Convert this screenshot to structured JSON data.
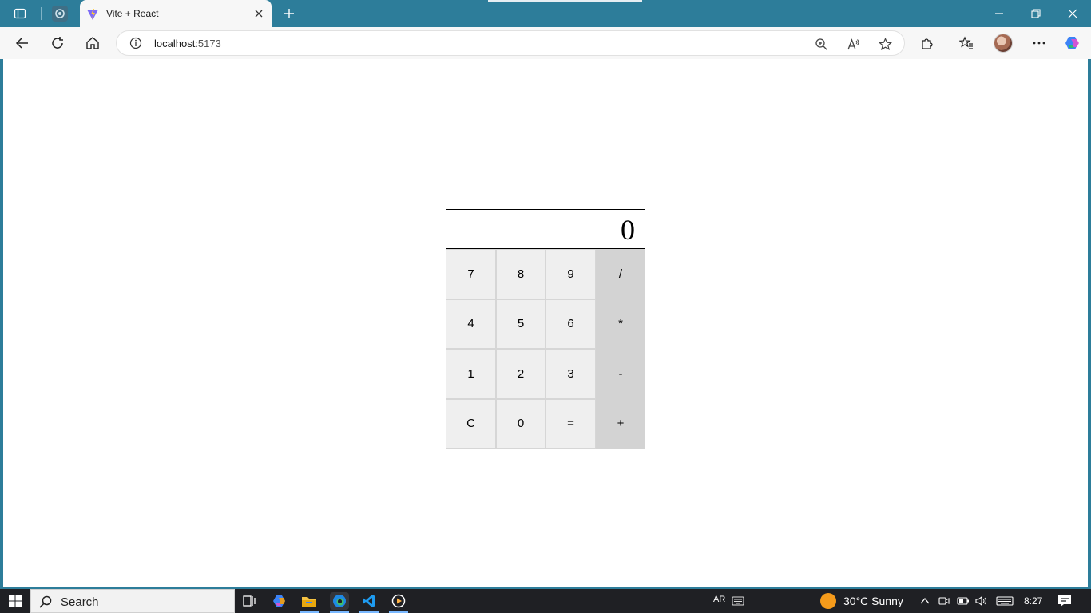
{
  "browser": {
    "tab_active_title": "Vite + React",
    "url_host": "localhost",
    "url_port": ":5173"
  },
  "calculator": {
    "display": "0",
    "keys": [
      {
        "label": "7",
        "kind": "digit"
      },
      {
        "label": "8",
        "kind": "digit"
      },
      {
        "label": "9",
        "kind": "digit"
      },
      {
        "label": "/",
        "kind": "op"
      },
      {
        "label": "4",
        "kind": "digit"
      },
      {
        "label": "5",
        "kind": "digit"
      },
      {
        "label": "6",
        "kind": "digit"
      },
      {
        "label": "*",
        "kind": "op"
      },
      {
        "label": "1",
        "kind": "digit"
      },
      {
        "label": "2",
        "kind": "digit"
      },
      {
        "label": "3",
        "kind": "digit"
      },
      {
        "label": "-",
        "kind": "op"
      },
      {
        "label": "C",
        "kind": "digit"
      },
      {
        "label": "0",
        "kind": "digit"
      },
      {
        "label": "=",
        "kind": "digit"
      },
      {
        "label": "+",
        "kind": "op"
      }
    ]
  },
  "taskbar": {
    "search_label": "Search",
    "input_lang": "AR",
    "weather": "30°C  Sunny",
    "time": "8:27"
  },
  "colors": {
    "titlebar": "#2d7d9a",
    "key_digit": "#efefef",
    "key_op": "#d3d3d3",
    "taskbar": "#1f2024"
  }
}
